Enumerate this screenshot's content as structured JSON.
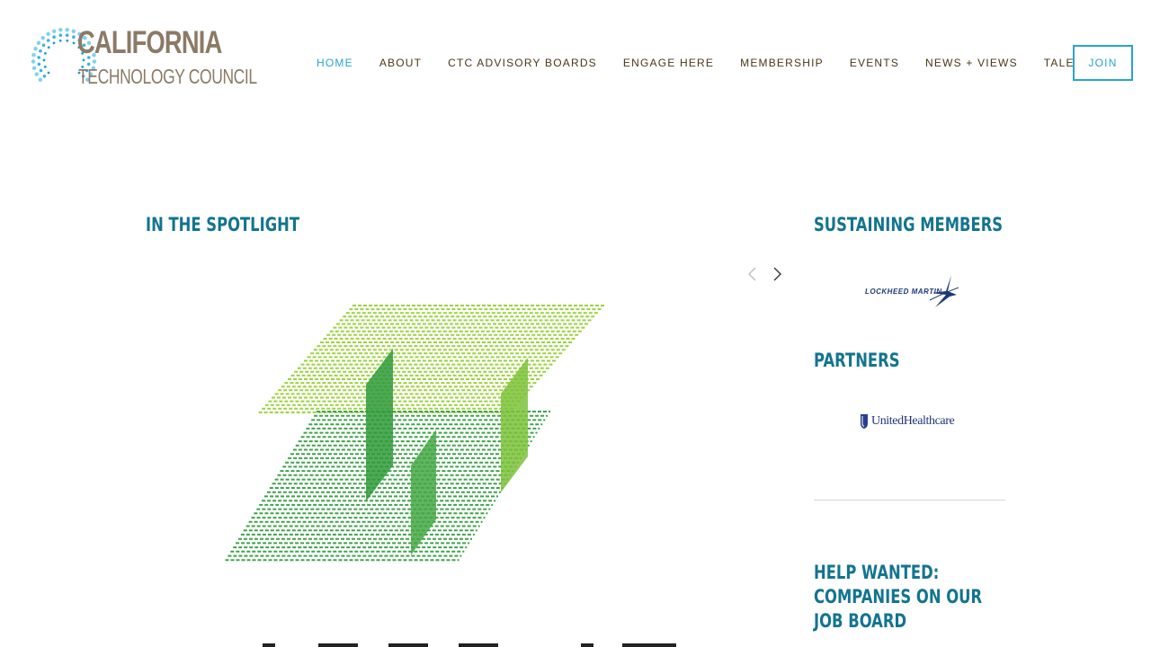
{
  "logo": {
    "line1": "CALIFORNIA",
    "line2": "TECHNOLOGY COUNCIL"
  },
  "nav": {
    "items": [
      {
        "label": "HOME",
        "active": true
      },
      {
        "label": "ABOUT",
        "active": false
      },
      {
        "label": "CTC ADVISORY BOARDS",
        "active": false
      },
      {
        "label": "ENGAGE HERE",
        "active": false
      },
      {
        "label": "MEMBERSHIP",
        "active": false
      },
      {
        "label": "EVENTS",
        "active": false
      },
      {
        "label": "NEWS + VIEWS",
        "active": false
      },
      {
        "label": "TALENT",
        "active": false
      }
    ],
    "join_label": "JOIN"
  },
  "spotlight": {
    "heading": "IN THE SPOTLIGHT"
  },
  "sidebar": {
    "sustaining_heading": "SUSTAINING MEMBERS",
    "sustaining_logo_text": "LOCKHEED MARTIN",
    "partners_heading": "PARTNERS",
    "partner_logo_text": "UnitedHealthcare",
    "help_heading": "HELP WANTED: COMPANIES ON OUR JOB BOARD"
  },
  "colors": {
    "accent": "#29a3d3",
    "heading": "#13748f",
    "nav_text": "#4a3716",
    "logo_brown": "#8b7a66"
  }
}
